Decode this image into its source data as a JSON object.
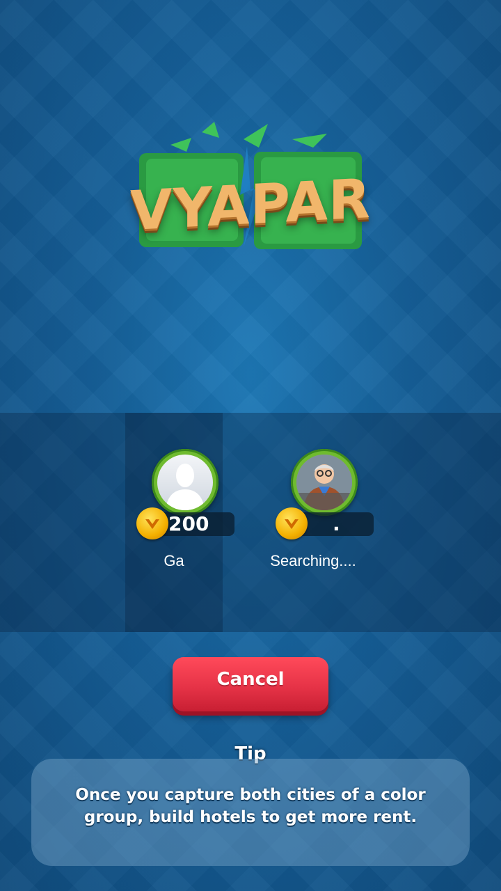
{
  "logo": {
    "text": "VYAPAR"
  },
  "players": [
    {
      "name": "Ga",
      "coins": "200"
    },
    {
      "name": "Searching....",
      "coins": "."
    }
  ],
  "cancel_label": "Cancel",
  "tip": {
    "title": "Tip",
    "text": "Once you capture both cities of a color group, build hotels to get more rent."
  },
  "colors": {
    "background": "#155f98",
    "accent_green": "#6fbb2f",
    "cancel_red": "#e63347",
    "coin_gold": "#f4b000"
  }
}
